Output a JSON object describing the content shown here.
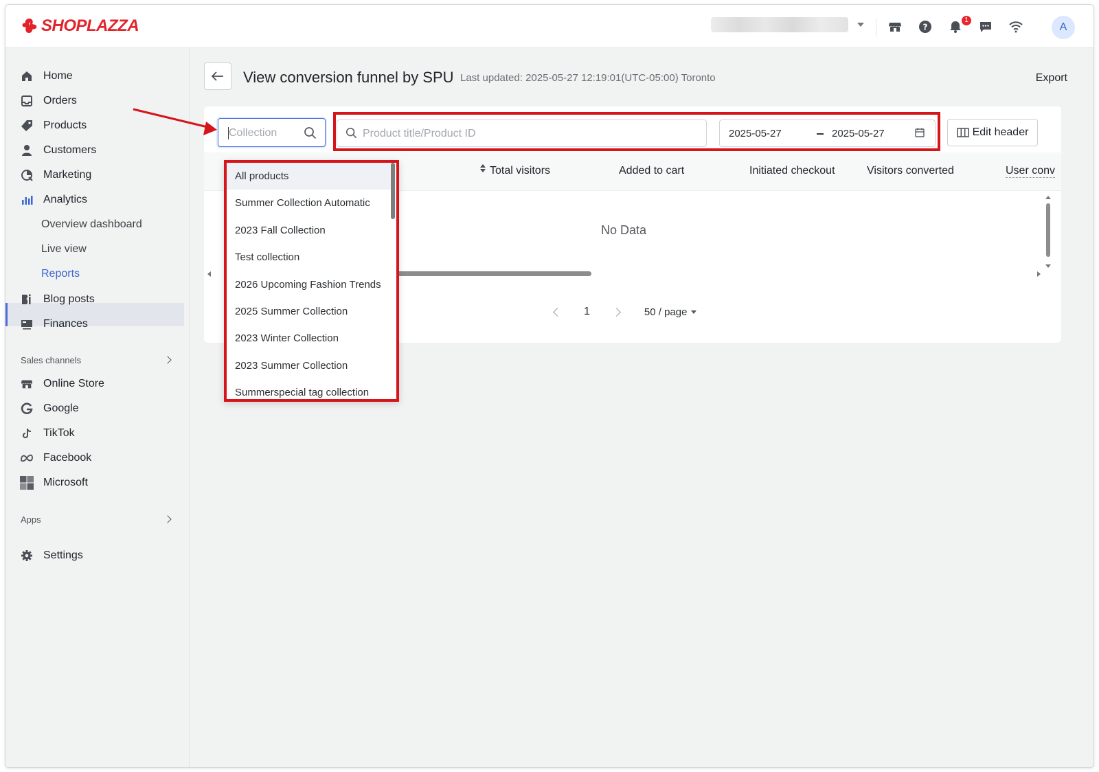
{
  "brand": {
    "logo_text": "SHOPLAZZA",
    "accent": "#e2232a"
  },
  "topbar": {
    "icons": [
      "store-icon",
      "help-icon",
      "bell-icon",
      "message-icon",
      "wifi-icon"
    ],
    "notification_count": "1",
    "avatar_letter": "A"
  },
  "sidebar": {
    "items": [
      {
        "label": "Home",
        "icon": "home-icon"
      },
      {
        "label": "Orders",
        "icon": "orders-icon"
      },
      {
        "label": "Products",
        "icon": "tag-icon"
      },
      {
        "label": "Customers",
        "icon": "person-icon"
      },
      {
        "label": "Marketing",
        "icon": "marketing-icon"
      },
      {
        "label": "Analytics",
        "icon": "bar-chart-icon"
      }
    ],
    "analytics_sub": [
      "Overview dashboard",
      "Live view",
      "Reports"
    ],
    "items2": [
      {
        "label": "Blog posts",
        "icon": "blog-icon"
      },
      {
        "label": "Finances",
        "icon": "finance-icon"
      }
    ],
    "sales_channels_label": "Sales channels",
    "channels": [
      {
        "label": "Online Store",
        "icon": "store-icon"
      },
      {
        "label": "Google",
        "icon": "google-icon"
      },
      {
        "label": "TikTok",
        "icon": "tiktok-icon"
      },
      {
        "label": "Facebook",
        "icon": "meta-icon"
      },
      {
        "label": "Microsoft",
        "icon": "microsoft-icon"
      }
    ],
    "apps_label": "Apps",
    "settings_label": "Settings",
    "active_color": "#3c66d0"
  },
  "page": {
    "title": "View conversion funnel by SPU",
    "last_updated": "Last updated: 2025-05-27 12:19:01(UTC-05:00) Toronto",
    "export_label": "Export"
  },
  "filters": {
    "collection_placeholder": "Collection",
    "product_placeholder": "Product title/Product ID",
    "date_start": "2025-05-27",
    "date_end": "2025-05-27",
    "edit_header_label": "Edit header"
  },
  "table": {
    "columns": [
      "Total visitors",
      "Added to cart",
      "Initiated checkout",
      "Visitors converted",
      "User conv"
    ],
    "empty_text": "No Data"
  },
  "pagination": {
    "current_page": "1",
    "page_size": "50 / page"
  },
  "collection_dropdown": {
    "options": [
      "All products",
      "Summer Collection Automatic",
      "2023 Fall Collection",
      "Test collection",
      "2026 Upcoming Fashion Trends",
      "2025 Summer Collection",
      "2023 Winter Collection",
      "2023 Summer Collection",
      "Summerspecial tag collection"
    ],
    "selected": "All products"
  },
  "annotation": {
    "highlight_color": "#d6141b"
  }
}
